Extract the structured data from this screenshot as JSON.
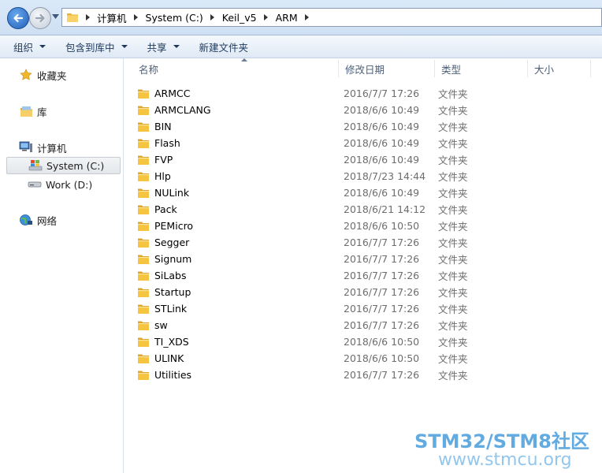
{
  "address_bar": {
    "breadcrumbs": [
      "计算机",
      "System (C:)",
      "Keil_v5",
      "ARM"
    ]
  },
  "toolbar": {
    "items": [
      {
        "label": "组织",
        "dropdown": true
      },
      {
        "label": "包含到库中",
        "dropdown": true
      },
      {
        "label": "共享",
        "dropdown": true
      },
      {
        "label": "新建文件夹",
        "dropdown": false
      }
    ]
  },
  "nav": {
    "favorites": "收藏夹",
    "libraries": "库",
    "computer": "计算机",
    "drive_c": "System (C:)",
    "drive_d": "Work (D:)",
    "network": "网络"
  },
  "columns": {
    "name": "名称",
    "date": "修改日期",
    "type": "类型",
    "size": "大小"
  },
  "files": [
    {
      "name": "ARMCC",
      "date": "2016/7/7 17:26",
      "type": "文件夹"
    },
    {
      "name": "ARMCLANG",
      "date": "2018/6/6 10:49",
      "type": "文件夹"
    },
    {
      "name": "BIN",
      "date": "2018/6/6 10:49",
      "type": "文件夹"
    },
    {
      "name": "Flash",
      "date": "2018/6/6 10:49",
      "type": "文件夹"
    },
    {
      "name": "FVP",
      "date": "2018/6/6 10:49",
      "type": "文件夹"
    },
    {
      "name": "Hlp",
      "date": "2018/7/23 14:44",
      "type": "文件夹"
    },
    {
      "name": "NULink",
      "date": "2018/6/6 10:49",
      "type": "文件夹"
    },
    {
      "name": "Pack",
      "date": "2018/6/21 14:12",
      "type": "文件夹"
    },
    {
      "name": "PEMicro",
      "date": "2018/6/6 10:50",
      "type": "文件夹"
    },
    {
      "name": "Segger",
      "date": "2016/7/7 17:26",
      "type": "文件夹"
    },
    {
      "name": "Signum",
      "date": "2016/7/7 17:26",
      "type": "文件夹"
    },
    {
      "name": "SiLabs",
      "date": "2016/7/7 17:26",
      "type": "文件夹"
    },
    {
      "name": "Startup",
      "date": "2016/7/7 17:26",
      "type": "文件夹"
    },
    {
      "name": "STLink",
      "date": "2016/7/7 17:26",
      "type": "文件夹"
    },
    {
      "name": "sw",
      "date": "2016/7/7 17:26",
      "type": "文件夹"
    },
    {
      "name": "TI_XDS",
      "date": "2018/6/6 10:50",
      "type": "文件夹"
    },
    {
      "name": "ULINK",
      "date": "2018/6/6 10:50",
      "type": "文件夹"
    },
    {
      "name": "Utilities",
      "date": "2016/7/7 17:26",
      "type": "文件夹"
    }
  ],
  "watermark": {
    "line1": "STM32/STM8社区",
    "line2": "www.stmcu.org"
  },
  "colors": {
    "folder": "#f5c542",
    "accent": "#2e8fd8"
  }
}
